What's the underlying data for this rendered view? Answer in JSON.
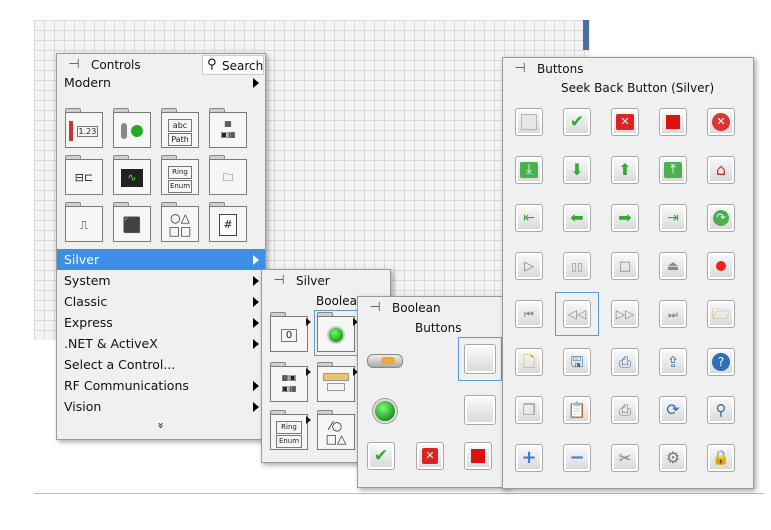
{
  "controls": {
    "title": "Controls",
    "search_label": "Search",
    "modern_label": "Modern",
    "tile_texts": {
      "num": "1.23",
      "string": "abc",
      "path": "Path",
      "ring": "Ring",
      "enum": "Enum",
      "decor": "#"
    },
    "menu": [
      {
        "label": "Silver",
        "has_sub": true,
        "selected": true
      },
      {
        "label": "System",
        "has_sub": true
      },
      {
        "label": "Classic",
        "has_sub": true
      },
      {
        "label": "Express",
        "has_sub": true
      },
      {
        "label": ".NET & ActiveX",
        "has_sub": true
      },
      {
        "label": "Select a Control...",
        "has_sub": false
      },
      {
        "label": "RF Communications",
        "has_sub": true
      },
      {
        "label": "Vision",
        "has_sub": true
      }
    ],
    "more_glyph": "»"
  },
  "silver": {
    "title": "Silver",
    "subtitle": "Boolean",
    "tile_texts": {
      "numeric": "0",
      "ring": "Ring",
      "enum": "Enum"
    }
  },
  "boolean": {
    "title": "Boolean",
    "subtitle": "Buttons"
  },
  "buttons": {
    "title": "Buttons",
    "tooltip": "Seek Back Button (Silver)",
    "grid": [
      [
        "blank-button",
        "checkmark-button",
        "x-button",
        "stop-button",
        "cancel-button"
      ],
      [
        "download-button",
        "down-arrow-button",
        "up-arrow-button",
        "upload-button",
        "home-button"
      ],
      [
        "first-button",
        "left-arrow-button",
        "right-arrow-button",
        "last-button",
        "redo-button"
      ],
      [
        "play-button",
        "pause-button",
        "stop-square-button",
        "eject-button",
        "record-button"
      ],
      [
        "seek-start-button",
        "seek-back-button",
        "seek-forward-button",
        "seek-end-button",
        "open-folder-button"
      ],
      [
        "new-document-button",
        "save-button",
        "save-as-button",
        "export-button",
        "help-button"
      ],
      [
        "copy-button",
        "paste-button",
        "print-button",
        "refresh-button",
        "zoom-button"
      ],
      [
        "plus-button",
        "minus-button",
        "tools-button",
        "settings-button",
        "lock-button"
      ]
    ]
  }
}
